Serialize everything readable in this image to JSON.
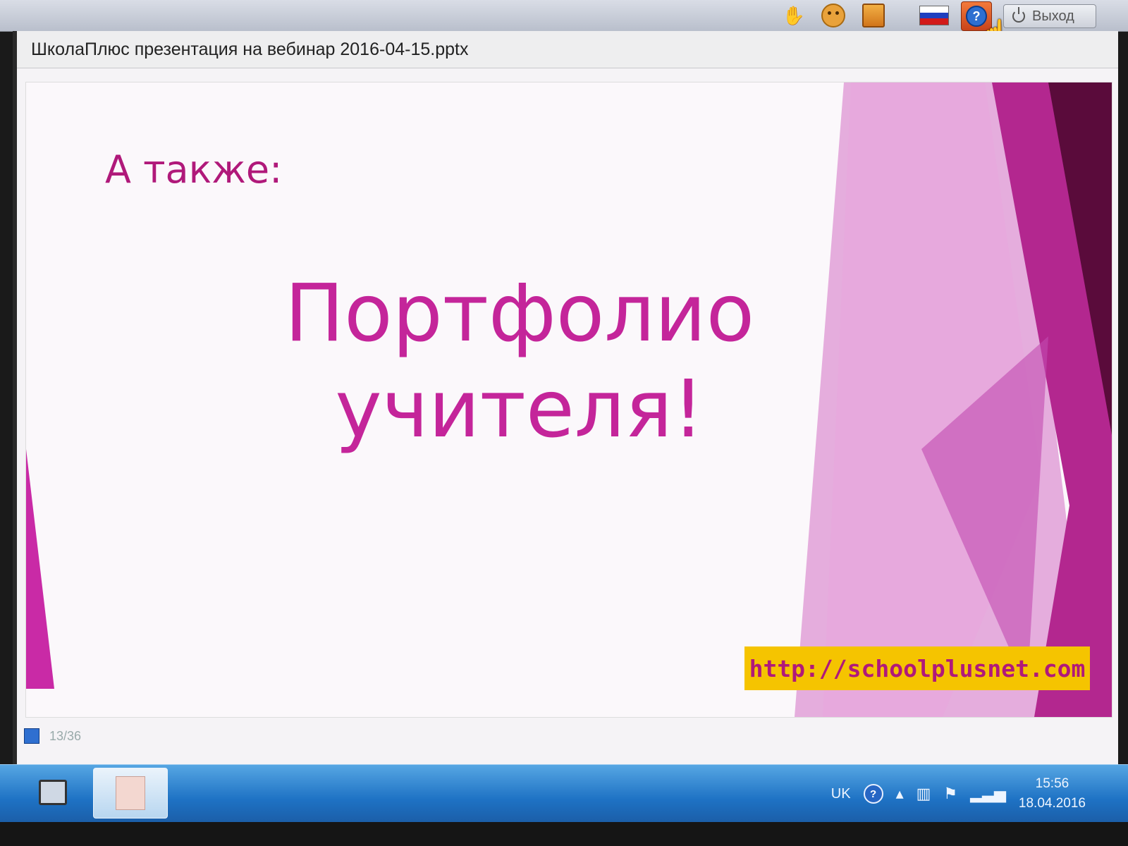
{
  "toolbar": {
    "exit_label": "Выход",
    "icons": [
      "hand-icon",
      "smile-icon",
      "notes-icon",
      "russian-flag-icon",
      "help-icon",
      "power-icon"
    ],
    "flag_colors": [
      "#ffffff",
      "#1f3fbf",
      "#d21a1a"
    ]
  },
  "window": {
    "title": "ШколаПлюс презентация на вебинар 2016-04-15.pptx"
  },
  "slide": {
    "heading": "А также:",
    "main_line1": "Портфолио",
    "main_line2": "учителя!",
    "url": "http://schoolplusnet.com",
    "accent_color": "#c4259a",
    "url_bg_color": "#f5c400"
  },
  "status": {
    "page_counter": "13/36"
  },
  "taskbar": {
    "language": "UK",
    "time": "15:56",
    "date": "18.04.2016"
  }
}
